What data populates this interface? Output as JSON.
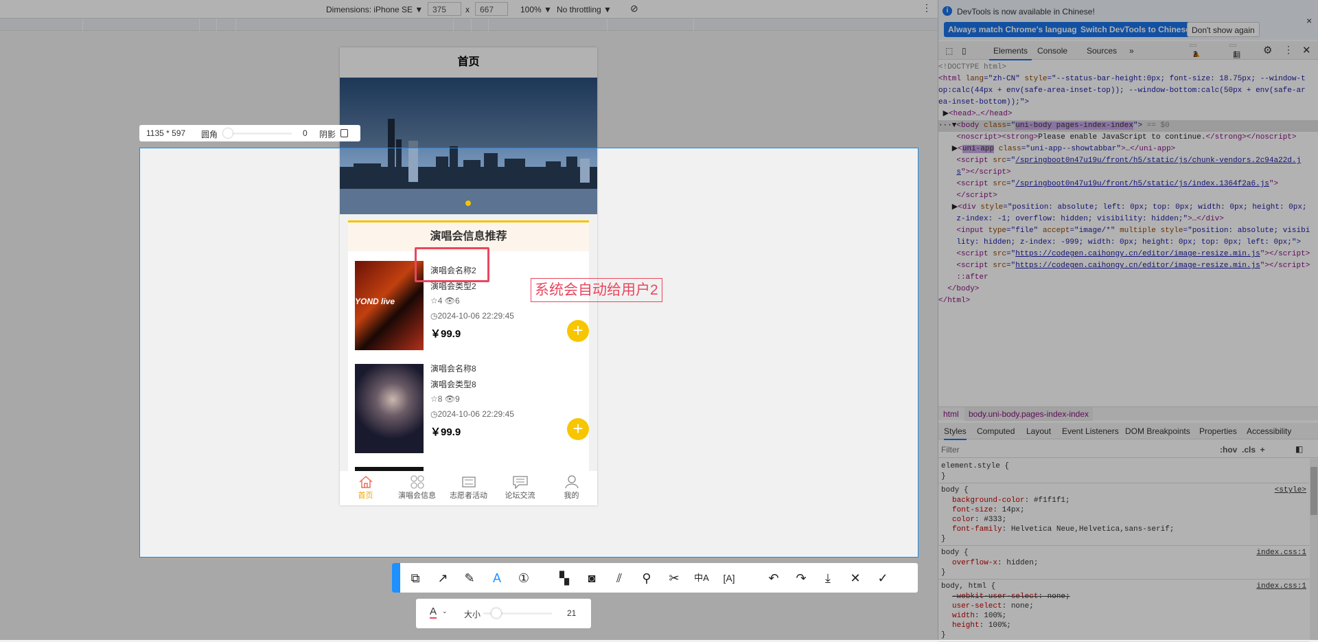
{
  "device_toolbar": {
    "dimensions": "Dimensions: iPhone SE ▼",
    "width": "375",
    "x": "x",
    "height": "667",
    "zoom": "100% ▼",
    "throttling": "No throttling ▼"
  },
  "phone": {
    "title": "首页",
    "section_title": "演唱会信息推荐",
    "items": [
      {
        "name": "演唱会名称2",
        "type": "演唱会类型2",
        "likes": "4",
        "views": "6",
        "time": "2024-10-06 22:29:45",
        "price": "￥99.9",
        "cover_text": "YOND live"
      },
      {
        "name": "演唱会名称8",
        "type": "演唱会类型8",
        "likes": "8",
        "views": "9",
        "time": "2024-10-06 22:29:45",
        "price": "￥99.9"
      }
    ],
    "tabs": [
      {
        "label": "首页",
        "icon": "home-icon",
        "active": true
      },
      {
        "label": "演唱会信息",
        "icon": "grid-icon"
      },
      {
        "label": "志愿者活动",
        "icon": "keyboard-icon"
      },
      {
        "label": "论坛交流",
        "icon": "chat-icon"
      },
      {
        "label": "我的",
        "icon": "user-icon"
      }
    ],
    "accent": "#f7c600"
  },
  "devtools": {
    "info": "DevTools is now available in Chinese!",
    "btn_match": "Always match Chrome's language",
    "btn_switch": "Switch DevTools to Chinese",
    "btn_dismiss": "Don't show again",
    "tabs": [
      "Elements",
      "Console",
      "Sources",
      "»"
    ],
    "errors": "1",
    "warnings": "3",
    "messages": "1",
    "dom_lines": [
      [
        [
          "<!DOCTYPE html>",
          "cm"
        ]
      ],
      [
        [
          "<html ",
          "tag"
        ],
        [
          "lang",
          "an"
        ],
        [
          "=\"zh-CN\" ",
          "av"
        ],
        [
          "style",
          "an"
        ],
        [
          "=\"--status-bar-height:0px; font-size: 18.75px; --window-t",
          "av"
        ]
      ],
      [
        [
          "op:calc(44px + env(safe-area-inset-top)); --window-bottom:calc(50px + env(safe-ar",
          "av"
        ]
      ],
      [
        [
          "ea-inset-bottom));\">",
          "av"
        ]
      ],
      [
        [
          " ▶",
          "tx"
        ],
        [
          "<head>…</head>",
          "tag"
        ]
      ],
      [
        [
          "···▼",
          "tx"
        ],
        [
          "<body ",
          "tag"
        ],
        [
          "class",
          "an"
        ],
        [
          "=\"",
          "av"
        ],
        [
          "uni-body pages-index-index",
          "hl"
        ],
        [
          "\"> ",
          "av"
        ],
        [
          "== $0",
          "cm"
        ]
      ],
      [
        [
          "    <noscript><strong>",
          "tag"
        ],
        [
          "Please enable JavaScript to continue.",
          "tx"
        ],
        [
          "</strong></noscript>",
          "tag"
        ]
      ],
      [
        [
          "   ▶",
          "tx"
        ],
        [
          "<",
          "tag"
        ],
        [
          "uni-app",
          "hl"
        ],
        [
          " class",
          "an"
        ],
        [
          "=\"uni-app--showtabbar\"",
          "av"
        ],
        [
          ">…</uni-app>",
          "tag"
        ]
      ],
      [
        [
          "    <script ",
          "tag"
        ],
        [
          "src",
          "an"
        ],
        [
          "=\"",
          "av"
        ],
        [
          "/springboot0n47u19u/front/h5/static/js/chunk-vendors.2c94a22d.j",
          "lk"
        ]
      ],
      [
        [
          "    ",
          "tx"
        ],
        [
          "s",
          "lk"
        ],
        [
          "\"></script>",
          "tag"
        ]
      ],
      [
        [
          "    <script ",
          "tag"
        ],
        [
          "src",
          "an"
        ],
        [
          "=\"",
          "av"
        ],
        [
          "/springboot0n47u19u/front/h5/static/js/index.1364f2a6.js",
          "lk"
        ],
        [
          "\">",
          "tag"
        ]
      ],
      [
        [
          "    </script>",
          "tag"
        ]
      ],
      [
        [
          "   ▶",
          "tx"
        ],
        [
          "<div ",
          "tag"
        ],
        [
          "style",
          "an"
        ],
        [
          "=\"position: absolute; left: 0px; top: 0px; width: 0px; height: 0px;",
          "av"
        ]
      ],
      [
        [
          "    z-index: -1; overflow: hidden; visibility: hidden;\"",
          "av"
        ],
        [
          ">…</div>",
          "tag"
        ]
      ],
      [
        [
          "    <input ",
          "tag"
        ],
        [
          "type",
          "an"
        ],
        [
          "=\"file\" ",
          "av"
        ],
        [
          "accept",
          "an"
        ],
        [
          "=\"image/*\" ",
          "av"
        ],
        [
          "multiple style",
          "an"
        ],
        [
          "=\"position: absolute; visibi",
          "av"
        ]
      ],
      [
        [
          "    lity: hidden; z-index: -999; width: 0px; height: 0px; top: 0px; left: 0px;\">",
          "av"
        ]
      ],
      [
        [
          "    <script ",
          "tag"
        ],
        [
          "src",
          "an"
        ],
        [
          "=\"",
          "av"
        ],
        [
          "https://codegen.caihongy.cn/editor/image-resize.min.js",
          "lk"
        ],
        [
          "\"></script>",
          "tag"
        ]
      ],
      [
        [
          "    <script ",
          "tag"
        ],
        [
          "src",
          "an"
        ],
        [
          "=\"",
          "av"
        ],
        [
          "https://codegen.caihongy.cn/editor/image-resize.min.js",
          "lk"
        ],
        [
          "\"></script>",
          "tag"
        ]
      ],
      [
        [
          "    ::after",
          "tag"
        ]
      ],
      [
        [
          "  </body>",
          "tag"
        ]
      ],
      [
        [
          "</html>",
          "tag"
        ]
      ]
    ],
    "breadcrumbs": [
      "html",
      "body.uni-body.pages-index-index"
    ],
    "style_tabs": [
      "Styles",
      "Computed",
      "Layout",
      "Event Listeners",
      "DOM Breakpoints",
      "Properties",
      "Accessibility"
    ],
    "filter_placeholder": "Filter",
    "filter_tools": ":hov  .cls  +",
    "rules": [
      {
        "selector": "element.style {",
        "source": "",
        "props": []
      },
      {
        "selector": "body {",
        "source": "<style>",
        "props": [
          [
            "background-color",
            "#f1f1f1;"
          ],
          [
            "font-size",
            "14px;"
          ],
          [
            "color",
            "#333;"
          ],
          [
            "font-family",
            "Helvetica Neue,Helvetica,sans-serif;"
          ]
        ]
      },
      {
        "selector": "body {",
        "source": "index.css:1",
        "props": [
          [
            "overflow-x",
            "hidden;"
          ]
        ]
      },
      {
        "selector": "body, html {",
        "source": "index.css:1",
        "props": [
          [
            "-webkit-user-select",
            "none;"
          ],
          [
            "user-select",
            "none;"
          ],
          [
            "width",
            "100%;"
          ],
          [
            "height",
            "100%;"
          ]
        ]
      }
    ]
  },
  "capture": {
    "size": "1135 * 597",
    "radius_label": "圆角",
    "radius_value": "0",
    "shadow_label": "阴影",
    "size_label": "大小",
    "font_size": "21",
    "annotation_text": "系统会自动给用户2",
    "annotation_color": "#e9465e",
    "tools": [
      "shape",
      "arrow",
      "pen",
      "text",
      "number",
      "mosaic",
      "blur",
      "hatch",
      "pin",
      "cut",
      "translate",
      "ocr",
      "undo",
      "redo",
      "download",
      "close",
      "confirm"
    ]
  }
}
